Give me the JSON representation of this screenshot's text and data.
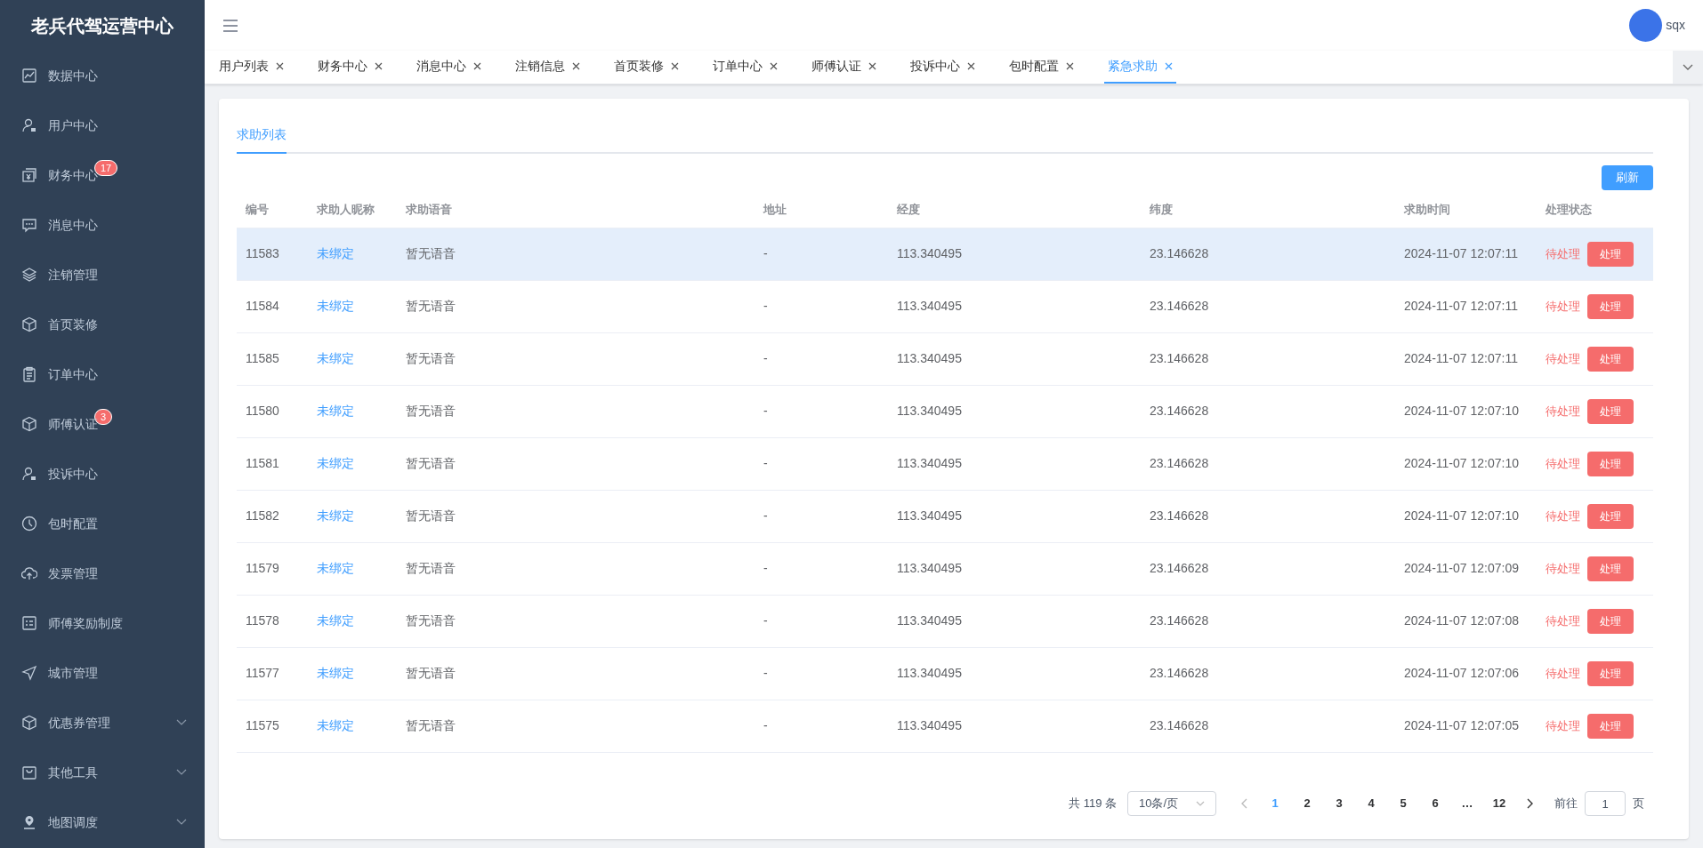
{
  "sidebar": {
    "title": "老兵代驾运营中心",
    "items": [
      {
        "label": "数据中心",
        "expandable": false
      },
      {
        "label": "用户中心",
        "expandable": false
      },
      {
        "label": "财务中心",
        "badge": "17",
        "expandable": false
      },
      {
        "label": "消息中心",
        "expandable": false
      },
      {
        "label": "注销管理",
        "expandable": false
      },
      {
        "label": "首页装修",
        "expandable": false
      },
      {
        "label": "订单中心",
        "expandable": false
      },
      {
        "label": "师傅认证",
        "badge": "3",
        "expandable": false
      },
      {
        "label": "投诉中心",
        "expandable": false
      },
      {
        "label": "包时配置",
        "expandable": false
      },
      {
        "label": "发票管理",
        "expandable": false
      },
      {
        "label": "师傅奖励制度",
        "expandable": false
      },
      {
        "label": "城市管理",
        "expandable": false
      },
      {
        "label": "优惠券管理",
        "expandable": true
      },
      {
        "label": "其他工具",
        "expandable": true
      },
      {
        "label": "地图调度",
        "expandable": true
      }
    ]
  },
  "header": {
    "user": "sqx"
  },
  "tabs": [
    {
      "label": "用户列表",
      "selected": false
    },
    {
      "label": "财务中心",
      "selected": false
    },
    {
      "label": "消息中心",
      "selected": false
    },
    {
      "label": "注销信息",
      "selected": false
    },
    {
      "label": "首页装修",
      "selected": false
    },
    {
      "label": "订单中心",
      "selected": false
    },
    {
      "label": "师傅认证",
      "selected": false
    },
    {
      "label": "投诉中心",
      "selected": false
    },
    {
      "label": "包时配置",
      "selected": false
    },
    {
      "label": "紧急求助",
      "selected": true
    }
  ],
  "page_tabs": [
    {
      "label": "求助列表",
      "selected": true
    }
  ],
  "refresh_button": "刷新",
  "table": {
    "columns": [
      "编号",
      "求助人昵称",
      "求助语音",
      "地址",
      "经度",
      "纬度",
      "求助时间",
      "处理状态"
    ],
    "rows": [
      {
        "id": "11583",
        "nickname": "未绑定",
        "voice": "暂无语音",
        "address": "-",
        "lng": "113.340495",
        "lat": "23.146628",
        "time": "2024-11-07 12:07:11",
        "status": "待处理",
        "action": "处理",
        "hovered": true
      },
      {
        "id": "11584",
        "nickname": "未绑定",
        "voice": "暂无语音",
        "address": "-",
        "lng": "113.340495",
        "lat": "23.146628",
        "time": "2024-11-07 12:07:11",
        "status": "待处理",
        "action": "处理",
        "hovered": false
      },
      {
        "id": "11585",
        "nickname": "未绑定",
        "voice": "暂无语音",
        "address": "-",
        "lng": "113.340495",
        "lat": "23.146628",
        "time": "2024-11-07 12:07:11",
        "status": "待处理",
        "action": "处理",
        "hovered": false
      },
      {
        "id": "11580",
        "nickname": "未绑定",
        "voice": "暂无语音",
        "address": "-",
        "lng": "113.340495",
        "lat": "23.146628",
        "time": "2024-11-07 12:07:10",
        "status": "待处理",
        "action": "处理",
        "hovered": false
      },
      {
        "id": "11581",
        "nickname": "未绑定",
        "voice": "暂无语音",
        "address": "-",
        "lng": "113.340495",
        "lat": "23.146628",
        "time": "2024-11-07 12:07:10",
        "status": "待处理",
        "action": "处理",
        "hovered": false
      },
      {
        "id": "11582",
        "nickname": "未绑定",
        "voice": "暂无语音",
        "address": "-",
        "lng": "113.340495",
        "lat": "23.146628",
        "time": "2024-11-07 12:07:10",
        "status": "待处理",
        "action": "处理",
        "hovered": false
      },
      {
        "id": "11579",
        "nickname": "未绑定",
        "voice": "暂无语音",
        "address": "-",
        "lng": "113.340495",
        "lat": "23.146628",
        "time": "2024-11-07 12:07:09",
        "status": "待处理",
        "action": "处理",
        "hovered": false
      },
      {
        "id": "11578",
        "nickname": "未绑定",
        "voice": "暂无语音",
        "address": "-",
        "lng": "113.340495",
        "lat": "23.146628",
        "time": "2024-11-07 12:07:08",
        "status": "待处理",
        "action": "处理",
        "hovered": false
      },
      {
        "id": "11577",
        "nickname": "未绑定",
        "voice": "暂无语音",
        "address": "-",
        "lng": "113.340495",
        "lat": "23.146628",
        "time": "2024-11-07 12:07:06",
        "status": "待处理",
        "action": "处理",
        "hovered": false
      },
      {
        "id": "11575",
        "nickname": "未绑定",
        "voice": "暂无语音",
        "address": "-",
        "lng": "113.340495",
        "lat": "23.146628",
        "time": "2024-11-07 12:07:05",
        "status": "待处理",
        "action": "处理",
        "hovered": false
      }
    ]
  },
  "pagination": {
    "total": "共 119 条",
    "page_size": "10条/页",
    "pages": [
      {
        "label": "1",
        "selected": true
      },
      {
        "label": "2",
        "selected": false
      },
      {
        "label": "3",
        "selected": false
      },
      {
        "label": "4",
        "selected": false
      },
      {
        "label": "5",
        "selected": false
      },
      {
        "label": "6",
        "selected": false
      },
      {
        "label": "…",
        "selected": false
      },
      {
        "label": "12",
        "selected": false
      }
    ],
    "goto_label": "前往",
    "goto_value": "1",
    "page_unit": "页"
  }
}
